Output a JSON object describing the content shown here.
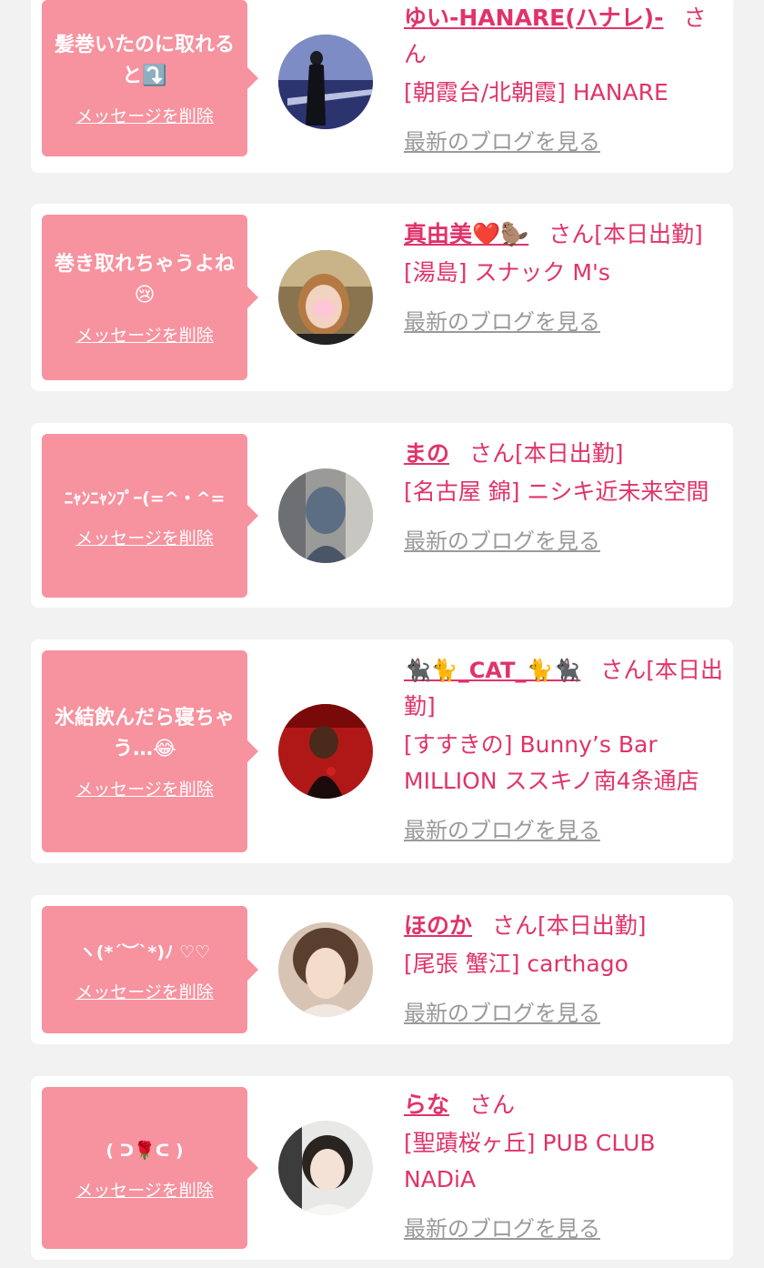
{
  "colors": {
    "bubble": "#f7929f",
    "accent": "#e0336a",
    "link_gray": "#9a9a9a",
    "background": "#f2f2f2"
  },
  "delete_label": "メッセージを削除",
  "blog_label": "最新のブログを見る",
  "honorific": "さん",
  "entries": [
    {
      "message": "髪巻いたのに取れると⤵️",
      "name": "ゆい-HANARE(ハナレ)-",
      "status": "",
      "shop": "[朝霞台/北朝霞] HANARE"
    },
    {
      "message": "巻き取れちゃうよね😢",
      "name": "真由美❤️🦫",
      "status": "[本日出勤]",
      "shop": "[湯島] スナック M's"
    },
    {
      "message": "ﾆｬﾝﾆｬﾝﾌﾟｰ(=^・^=",
      "name": "まの",
      "status": "[本日出勤]",
      "shop": "[名古屋 錦] ニシキ近未来空間"
    },
    {
      "message": "氷結飲んだら寝ちゃう…😂",
      "name": "🐈‍⬛🐈_CAT_🐈🐈‍⬛",
      "status": "[本日出勤]",
      "shop": "[すすきの] Bunny’s Bar MILLION ススキノ南4条通店"
    },
    {
      "message": "ヽ(*´︶`*)ﾉ ♡♡",
      "name": "ほのか",
      "status": "[本日出勤]",
      "shop": "[尾張 蟹江] carthago"
    },
    {
      "message": "( ᑐ🌹ᑕ )",
      "name": "らな",
      "status": "",
      "shop": "[聖蹟桜ヶ丘] PUB CLUB NADiA"
    }
  ]
}
